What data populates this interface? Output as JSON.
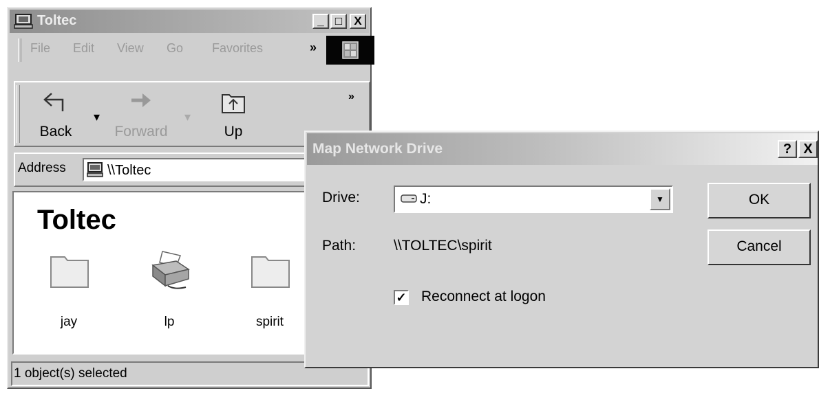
{
  "explorer": {
    "title": "Toltec",
    "menu": [
      "File",
      "Edit",
      "View",
      "Go",
      "Favorites"
    ],
    "menu_more": "»",
    "toolbar": {
      "back": "Back",
      "forward": "Forward",
      "up": "Up",
      "more": "»"
    },
    "address_label": "Address",
    "address_value": "\\\\Toltec",
    "folder_title": "Toltec",
    "items": [
      {
        "name": "jay",
        "icon": "folder-icon"
      },
      {
        "name": "lp",
        "icon": "printer-icon"
      },
      {
        "name": "spirit",
        "icon": "folder-icon"
      }
    ],
    "status": "1 object(s) selected",
    "caption_buttons": {
      "minimize": "_",
      "maximize": "□",
      "close": "X"
    }
  },
  "dialog": {
    "title": "Map Network Drive",
    "help_button": "?",
    "close_button": "X",
    "drive_label": "Drive:",
    "drive_value": "J:",
    "path_label": "Path:",
    "path_value": "\\\\TOLTEC\\spirit",
    "reconnect_label": "Reconnect at logon",
    "reconnect_checked": true,
    "ok_label": "OK",
    "cancel_label": "Cancel"
  },
  "colors": {
    "window": "#cfcfcf",
    "titlebar": "#8e8e8e",
    "content": "#ffffff"
  }
}
